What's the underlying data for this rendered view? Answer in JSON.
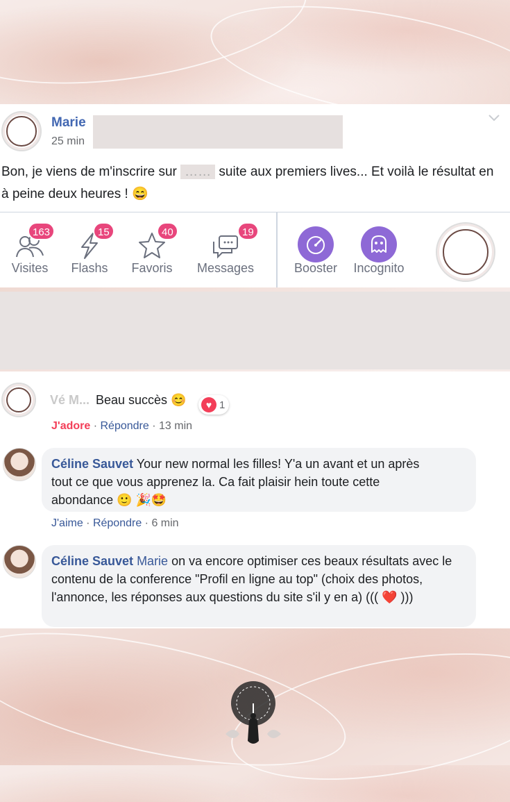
{
  "post": {
    "author": "Marie",
    "time": "25 min",
    "text_before": "Bon, je viens de m'inscrire sur ",
    "text_hidden": "……",
    "text_after": " suite aux premiers lives... Et voilà le résultat en à peine deux heures ! 😄",
    "menu_icon": "chevron-down-icon"
  },
  "stats": [
    {
      "label": "Visites",
      "count": "163",
      "icon": "people-icon"
    },
    {
      "label": "Flashs",
      "count": "15",
      "icon": "flash-icon"
    },
    {
      "label": "Favoris",
      "count": "40",
      "icon": "star-icon"
    },
    {
      "label": "Messages",
      "count": "19",
      "icon": "messages-icon"
    },
    {
      "label": "Booster",
      "icon": "speedometer-icon"
    },
    {
      "label": "Incognito",
      "icon": "ghost-icon"
    }
  ],
  "comments": [
    {
      "name_hidden": "Vé M...",
      "text": "Beau succès 😊",
      "reaction_count": "1",
      "like": "J'adore",
      "reply": "Répondre",
      "time": "13 min"
    },
    {
      "name": "Céline Sauvet",
      "text": "Your new normal les filles! Y'a un avant et un après tout ce que vous apprenez la. Ca fait plaisir hein toute cette abondance 🙂 🎉🤩",
      "like": "J'aime",
      "reply": "Répondre",
      "time": "6 min"
    },
    {
      "name": "Céline Sauvet",
      "mention": "Marie",
      "text": " on va encore optimiser ces beaux résultats avec le contenu de la conference \"Profil en ligne au top\" (choix des photos, l'annonce, les réponses aux questions du site s'il y en a) ((( ❤️ )))"
    }
  ],
  "colors": {
    "link": "#385898",
    "badge": "#e8467c",
    "purple": "#8e69d6",
    "love": "#f33e58"
  }
}
